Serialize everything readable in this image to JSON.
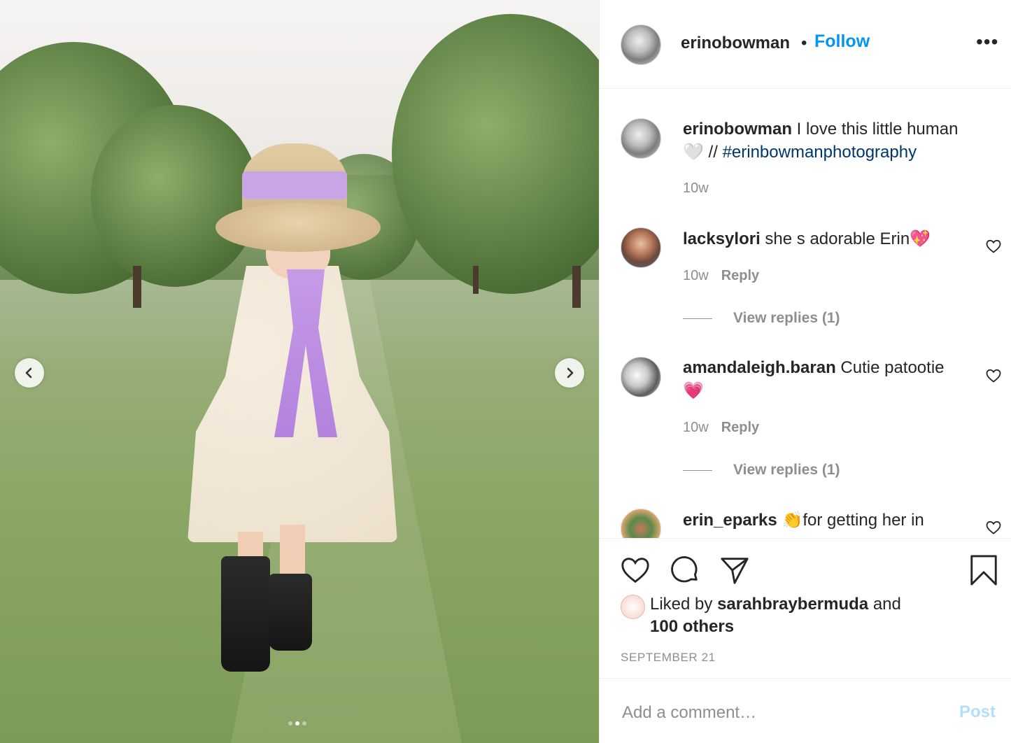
{
  "post": {
    "author": "erinobowman",
    "follow_label": "Follow",
    "bullet": "•",
    "more_label": "•••"
  },
  "caption": {
    "user": "erinobowman",
    "text": " I love this little human ",
    "emoji": "🤍",
    "separator": " // ",
    "hashtag": "#erinbowmanphotography",
    "time": "10w"
  },
  "comments": [
    {
      "user": "lacksylori",
      "text": " she s adorable Erin",
      "emoji": "💖",
      "time": "10w",
      "reply_label": "Reply",
      "view_replies": "View replies (1)"
    },
    {
      "user": "amandaleigh.baran",
      "text": " Cutie patootie",
      "emoji": "💗",
      "time": "10w",
      "reply_label": "Reply",
      "view_replies": "View replies (1)"
    },
    {
      "user": "erin_eparks",
      "emoji": "👏",
      "text": "for getting her in"
    }
  ],
  "likes": {
    "prefix": "Liked by ",
    "user": "sarahbraybermuda",
    "middle": " and",
    "others": "100 others"
  },
  "date": "SEPTEMBER 21",
  "add_comment": {
    "placeholder": "Add a comment…",
    "post_label": "Post"
  },
  "colors": {
    "link_blue": "#0095f6",
    "hashtag": "#00376b",
    "muted": "#8e8e8e",
    "post_disabled": "#b2dffc"
  },
  "icons": [
    "chevron-left-icon",
    "chevron-right-icon",
    "more-icon",
    "heart-icon",
    "comment-icon",
    "share-icon",
    "bookmark-icon"
  ]
}
